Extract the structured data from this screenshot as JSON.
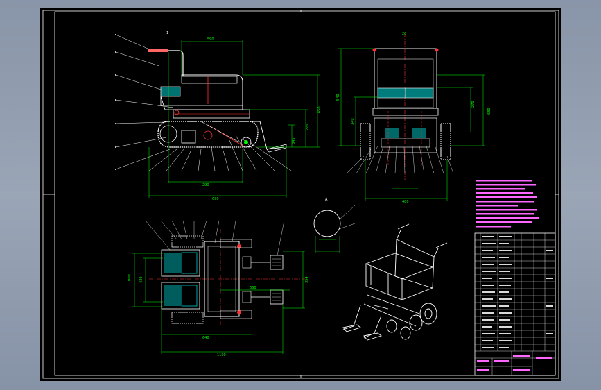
{
  "colors": {
    "sheet": "#000000",
    "frame": "#ffffff",
    "dimension": "#00ff00",
    "centerline": "#ff3333",
    "parts": "#ffffff",
    "hatch": "#00e5e5",
    "notes": "#ff66ff",
    "title_block": "#ffffff",
    "title_text": "#ff66ff"
  },
  "views": {
    "side": {
      "dims": [
        "590",
        "490",
        "650",
        "270",
        "345",
        "290",
        "690"
      ]
    },
    "front": {
      "dims": [
        "20",
        "540",
        "340",
        "680",
        "270",
        "400"
      ]
    },
    "top": {
      "dims": [
        "1000",
        "430",
        "660",
        "354",
        "640",
        "1100"
      ]
    },
    "detail": {
      "label": "A"
    },
    "iso": {}
  },
  "notes": {
    "lines": 8
  },
  "title_block": {
    "rows": 18
  }
}
